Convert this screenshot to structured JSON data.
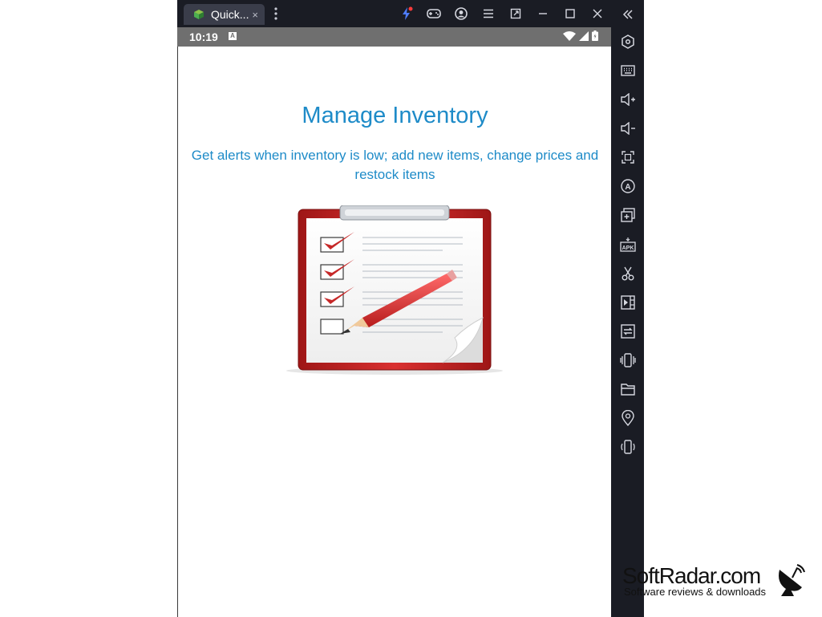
{
  "titlebar": {
    "tab_label": "Quick...",
    "tab_close": "×",
    "icons": [
      "boost-icon",
      "gamepad-icon",
      "account-icon",
      "menu-icon",
      "restore-window-icon",
      "minimize-icon",
      "maximize-icon",
      "close-icon"
    ]
  },
  "statusbar": {
    "time": "10:19",
    "notification_glyph": "A"
  },
  "onboarding": {
    "title": "Manage Inventory",
    "subtitle": "Get alerts when inventory is low; add new items, change prices and restock items",
    "checklist": {
      "checked": 3,
      "unchecked": 1
    }
  },
  "sidebar": {
    "icons": [
      "collapse-icon",
      "settings-hex-icon",
      "keyboard-icon",
      "volume-up-icon",
      "volume-down-icon",
      "screenshot-icon",
      "auto-rotate-icon",
      "multi-instance-icon",
      "install-apk-icon",
      "scissors-icon",
      "video-record-icon",
      "sync-icon",
      "shake-icon",
      "folder-icon",
      "location-icon",
      "rotate-icon"
    ]
  },
  "watermark": {
    "brand": "SoftRadar.com",
    "tagline": "Software reviews & downloads"
  },
  "colors": {
    "accent": "#1e8bc8",
    "chrome": "#1a1c24",
    "statusbar": "#6f6f6f",
    "clipboard_red": "#c62828"
  }
}
